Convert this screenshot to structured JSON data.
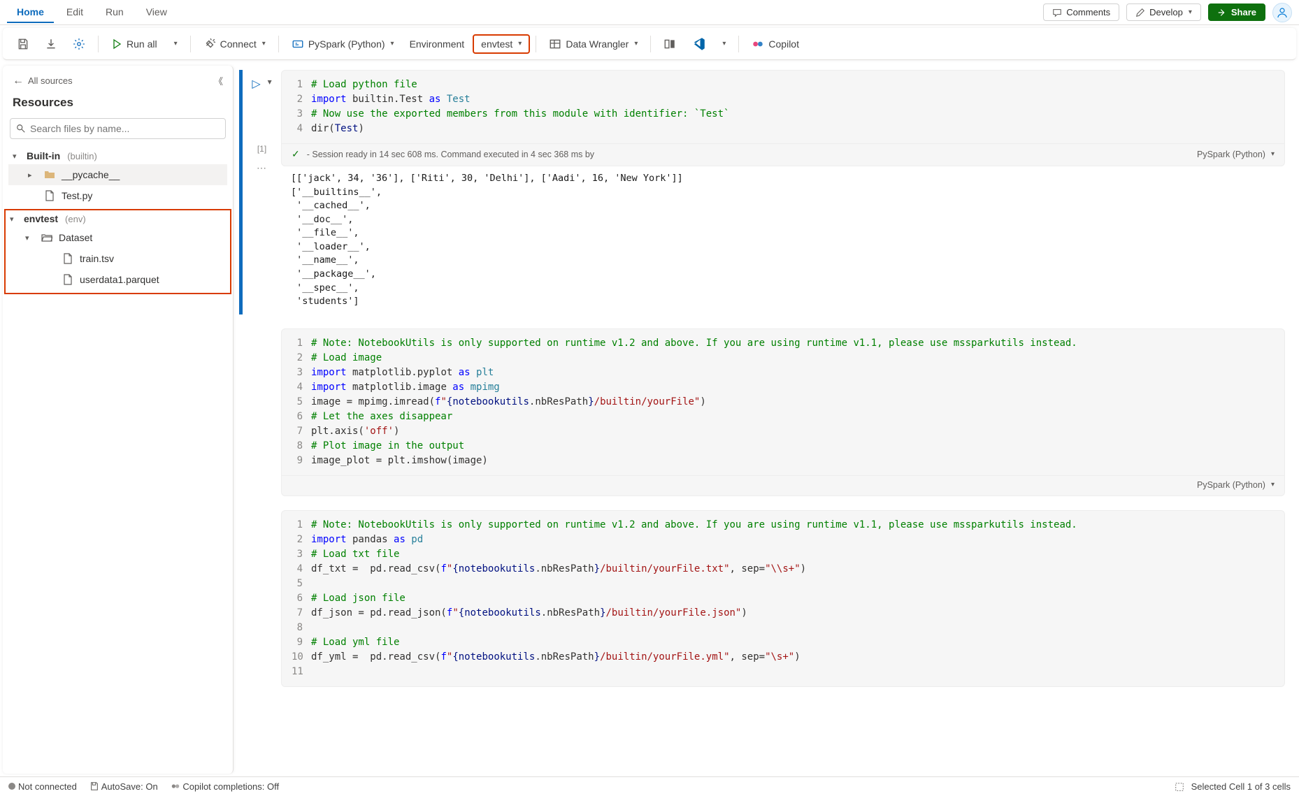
{
  "menubar": {
    "items": [
      "Home",
      "Edit",
      "Run",
      "View"
    ],
    "active": "Home"
  },
  "topright": {
    "comments": "Comments",
    "develop": "Develop",
    "share": "Share"
  },
  "toolbar": {
    "run_all": "Run all",
    "connect": "Connect",
    "pyspark": "PySpark (Python)",
    "environment": "Environment",
    "envtest": "envtest",
    "data_wrangler": "Data Wrangler",
    "copilot": "Copilot"
  },
  "sidebar": {
    "all_sources": "All sources",
    "title": "Resources",
    "search_placeholder": "Search files by name...",
    "groups": {
      "builtin": {
        "label": "Built-in",
        "sub": "(builtin)"
      },
      "envtest": {
        "label": "envtest",
        "sub": "(env)"
      }
    },
    "items": {
      "pycache": "__pycache__",
      "testpy": "Test.py",
      "dataset": "Dataset",
      "train": "train.tsv",
      "userdata": "userdata1.parquet"
    }
  },
  "celltoolbar": {
    "i0": "toggle-param-icon",
    "i1": "M↓",
    "i2": "focus-icon",
    "i3": "copy-icon",
    "i4": "lock-icon",
    "i5": "more-icon",
    "i6": "delete-icon"
  },
  "cell1": {
    "gutter_index": "[1]",
    "lines": {
      "l1_comment": "# Load python file",
      "l2_kw1": "import",
      "l2_mod": " builtin.Test ",
      "l2_kw2": "as",
      "l2_name": " Test",
      "l3_comment": "# Now use the exported members from this module with identifier: `Test`",
      "l4_pre": "dir(",
      "l4_id": "Test",
      "l4_post": ")"
    },
    "exec": {
      "text": "- Session ready in 14 sec 608 ms. Command executed in 4 sec 368 ms by",
      "lang": "PySpark (Python)"
    },
    "output": "[['jack', 34, '36'], ['Riti', 30, 'Delhi'], ['Aadi', 16, 'New York']]\n['__builtins__',\n '__cached__',\n '__doc__',\n '__file__',\n '__loader__',\n '__name__',\n '__package__',\n '__spec__',\n 'students']"
  },
  "cell2": {
    "lines": {
      "l1_comment": "# Note: NotebookUtils is only supported on runtime v1.2 and above. If you are using runtime v1.1, please use mssparkutils instead.",
      "l2_comment": "# Load image",
      "l3_kw1": "import",
      "l3_mod": " matplotlib.pyplot ",
      "l3_kw2": "as",
      "l3_name": " plt",
      "l4_kw1": "import",
      "l4_mod": " matplotlib.image ",
      "l4_kw2": "as",
      "l4_name": " mpimg",
      "l5_pre": "image = mpimg.imread(",
      "l5_kw": "f",
      "l5_s1": "\"",
      "l5_b1": "{",
      "l5_id1": "notebookutils",
      "l5_dot": ".nbResPath",
      "l5_b2": "}",
      "l5_s2": "/builtin/yourFile\"",
      "l5_post": ")",
      "l6_comment": "# Let the axes disappear",
      "l7_pre": "plt.axis(",
      "l7_str": "'off'",
      "l7_post": ")",
      "l8_comment": "# Plot image in the output",
      "l9": "image_plot = plt.imshow(image)"
    },
    "lang": "PySpark (Python)"
  },
  "cell3": {
    "lines": {
      "l1_comment": "# Note: NotebookUtils is only supported on runtime v1.2 and above. If you are using runtime v1.1, please use mssparkutils instead.",
      "l2_kw1": "import",
      "l2_mod": " pandas ",
      "l2_kw2": "as",
      "l2_name": " pd",
      "l3_comment": "# Load txt file",
      "l4_pre": "df_txt =  pd.read_csv(",
      "l4_kw": "f",
      "l4_s1": "\"",
      "l4_b1": "{",
      "l4_id": "notebookutils",
      "l4_dot": ".nbResPath",
      "l4_b2": "}",
      "l4_s2": "/builtin/yourFile.txt\"",
      "l4_mid": ", sep=",
      "l4_sep": "\"\\\\s+\"",
      "l4_post": ")",
      "l6_comment": "# Load json file",
      "l7_pre": "df_json = pd.read_json(",
      "l7_kw": "f",
      "l7_s1": "\"",
      "l7_b1": "{",
      "l7_id": "notebookutils",
      "l7_dot": ".nbResPath",
      "l7_b2": "}",
      "l7_s2": "/builtin/yourFile.json\"",
      "l7_post": ")",
      "l9_comment": "# Load yml file",
      "l10_pre": "df_yml =  pd.read_csv(",
      "l10_kw": "f",
      "l10_s1": "\"",
      "l10_b1": "{",
      "l10_id": "notebookutils",
      "l10_dot": ".nbResPath",
      "l10_b2": "}",
      "l10_s2": "/builtin/yourFile.yml\"",
      "l10_mid": ", sep=",
      "l10_sep": "\"\\s+\"",
      "l10_post": ")"
    }
  },
  "statusbar": {
    "not_connected": "Not connected",
    "autosave": "AutoSave: On",
    "copilot": "Copilot completions: Off",
    "selection": "Selected Cell 1 of 3 cells"
  }
}
